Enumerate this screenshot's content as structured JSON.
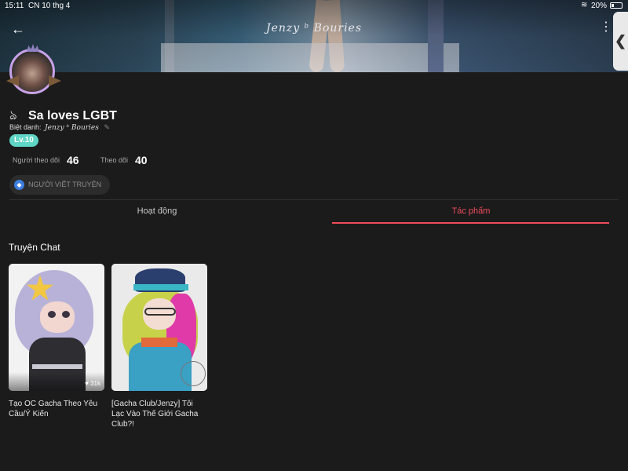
{
  "status_bar": {
    "time": "15:11",
    "date": "CN 10 thg 4",
    "battery": "20%",
    "wifi_icon": "wifi-icon"
  },
  "header": {
    "back_icon": "←",
    "title": "Jenzy ᵇ Bouries",
    "more_icon": "⋮"
  },
  "side_tab": {
    "icon": "❮"
  },
  "profile": {
    "name": "Sa loves LGBT",
    "name_prefix_icon": "ঌ",
    "nickname_label": "Biệt danh:",
    "nickname_value": "Jenzy ᵇ Bouries",
    "edit_icon": "✎",
    "level": "Lv.10",
    "followers_label": "Người theo dõi",
    "followers": "46",
    "following_label": "Theo dõi",
    "following": "40",
    "badge_label": "NGƯỜI VIẾT TRUYỆN",
    "badge_icon": "◆"
  },
  "tabs": [
    {
      "label": "Hoạt động",
      "active": false
    },
    {
      "label": "Tác phẩm",
      "active": true
    }
  ],
  "section": {
    "title": "Truyện Chat"
  },
  "stories": [
    {
      "title": "Tạo OC Gacha Theo Yêu Cầu/Ý Kiến",
      "likes": "31k"
    },
    {
      "title": "[Gacha Club/Jenzy] Tôi Lạc Vào Thế Giới Gacha Club?!",
      "likes": ""
    }
  ],
  "colors": {
    "accent": "#f04b5a",
    "level_badge": "#5fd5c6",
    "background": "#1b1b1b"
  }
}
